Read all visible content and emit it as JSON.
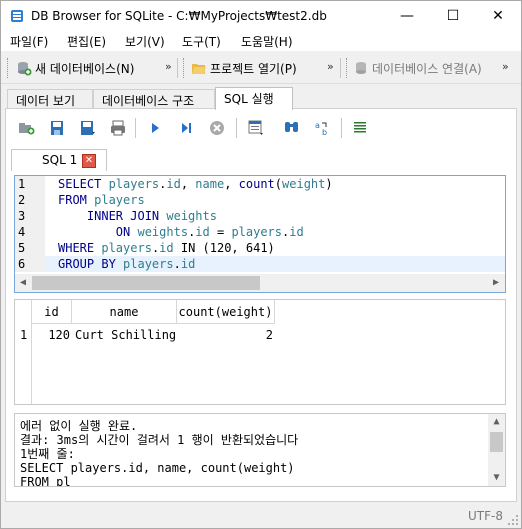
{
  "window": {
    "title": "DB Browser for SQLite - C:₩MyProjects₩test2.db",
    "minimize": "—",
    "maximize": "☐",
    "close": "✕"
  },
  "menubar": {
    "items": [
      "파일(F)",
      "편집(E)",
      "보기(V)",
      "도구(T)",
      "도움말(H)"
    ]
  },
  "toolbar": {
    "new_db": "새 데이터베이스(N)",
    "open_project": "프로젝트 열기(P)",
    "connect_db": "데이터베이스 연결(A)",
    "overflow": "»"
  },
  "tabs": [
    "데이터 보기",
    "데이터베이스 구조",
    "SQL 실행"
  ],
  "active_tab": "SQL 실행",
  "sql_tab": {
    "label": "SQL 1",
    "close": "✕"
  },
  "editor": {
    "line_numbers": [
      "1",
      "2",
      "3",
      "4",
      "5",
      "6"
    ],
    "lines": [
      [
        {
          "t": "SELECT ",
          "c": "kw"
        },
        {
          "t": "players",
          "c": "ident"
        },
        {
          "t": ".",
          "c": "num"
        },
        {
          "t": "id",
          "c": "ident"
        },
        {
          "t": ", ",
          "c": "num"
        },
        {
          "t": "name",
          "c": "ident"
        },
        {
          "t": ", ",
          "c": "num"
        },
        {
          "t": "count",
          "c": "kw"
        },
        {
          "t": "(",
          "c": "num"
        },
        {
          "t": "weight",
          "c": "ident"
        },
        {
          "t": ")",
          "c": "num"
        }
      ],
      [
        {
          "t": "FROM ",
          "c": "kw"
        },
        {
          "t": "players",
          "c": "ident"
        }
      ],
      [
        {
          "t": "    INNER JOIN ",
          "c": "kw"
        },
        {
          "t": "weights",
          "c": "ident"
        }
      ],
      [
        {
          "t": "        ON ",
          "c": "kw"
        },
        {
          "t": "weights",
          "c": "ident"
        },
        {
          "t": ".",
          "c": "num"
        },
        {
          "t": "id",
          "c": "ident"
        },
        {
          "t": " = ",
          "c": "num"
        },
        {
          "t": "players",
          "c": "ident"
        },
        {
          "t": ".",
          "c": "num"
        },
        {
          "t": "id",
          "c": "ident"
        }
      ],
      [
        {
          "t": "WHERE ",
          "c": "kw"
        },
        {
          "t": "players",
          "c": "ident"
        },
        {
          "t": ".",
          "c": "num"
        },
        {
          "t": "id",
          "c": "ident"
        },
        {
          "t": " IN (120, 641)",
          "c": "num"
        }
      ],
      [
        {
          "t": "GROUP BY ",
          "c": "kw"
        },
        {
          "t": "players",
          "c": "ident"
        },
        {
          "t": ".",
          "c": "num"
        },
        {
          "t": "id",
          "c": "ident"
        }
      ]
    ]
  },
  "results": {
    "columns": [
      "id",
      "name",
      "count(weight)"
    ],
    "rows": [
      {
        "row_number": "1",
        "cells": [
          "120",
          "Curt Schilling",
          "2"
        ]
      }
    ]
  },
  "messages": {
    "lines": [
      "에러 없이 실행 완료.",
      "결과: 3ms의 시간이 걸려서 1 행이 반환되었습니다",
      "1번째 줄:",
      "SELECT players.id, name, count(weight)",
      "FROM pl"
    ]
  },
  "status": {
    "encoding": "UTF-8"
  },
  "colors": {
    "keyword": "#00008b",
    "identifier": "#2e7d8f",
    "highlight": "#e8f2fe",
    "close_tab": "#e05a4a"
  }
}
